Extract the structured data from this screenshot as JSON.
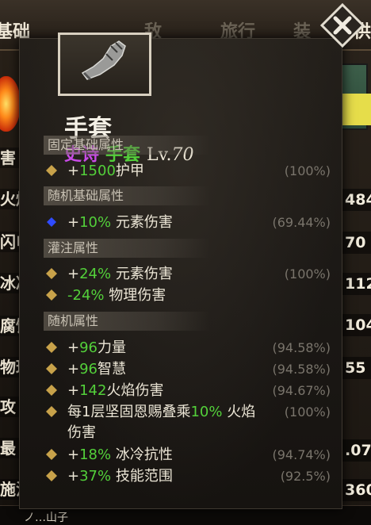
{
  "background": {
    "tabs": [
      "基础",
      "敌",
      "旅行",
      "装",
      "供"
    ],
    "left_labels": [
      "害",
      "火焰",
      "闪电",
      "冰冷",
      "腐蚀",
      "物理",
      "攻",
      "最",
      "施法"
    ],
    "right_values": [
      "484",
      "70",
      "112",
      "104",
      "55",
      ".07",
      "360"
    ],
    "bottom_text": "ノ…山子"
  },
  "item": {
    "name": "手套",
    "rarity": "史诗",
    "type": "手套",
    "level_prefix": "Lv.",
    "level": "70"
  },
  "close_icon": "close-icon",
  "sections": {
    "fixed_base": "固定基础属性",
    "random_base": "随机基础属性",
    "infusion": "灌注属性",
    "random": "随机属性"
  },
  "affixes": {
    "armor": {
      "prefix": "+",
      "value": "1500",
      "text": "护甲",
      "pct": "(100%)"
    },
    "elemental": {
      "prefix": "+",
      "value": "10",
      "unit": "%",
      "text": " 元素伤害",
      "pct": "(69.44%)"
    },
    "infuse_elemental": {
      "prefix": "+",
      "value": "24",
      "unit": "%",
      "text": " 元素伤害",
      "pct": "(100%)"
    },
    "infuse_physical": {
      "value": "-24",
      "unit": "%",
      "text": " 物理伤害"
    },
    "strength": {
      "prefix": "+",
      "value": "96",
      "text": "力量",
      "pct": "(94.58%)"
    },
    "intelligence": {
      "prefix": "+",
      "value": "96",
      "text": "智慧",
      "pct": "(94.58%)"
    },
    "fire": {
      "prefix": "+",
      "value": "142",
      "text": "火焰伤害",
      "pct": "(94.67%)"
    },
    "stack": {
      "pre": "每1层坚固恩赐叠乘",
      "value": "10",
      "unit": "%",
      "text": " 火焰",
      "line2": "伤害",
      "pct": "(100%)"
    },
    "cold_res": {
      "prefix": "+",
      "value": "18",
      "unit": "%",
      "text": " 冰冷抗性",
      "pct": "(94.74%)"
    },
    "skill_area": {
      "prefix": "+",
      "value": "37",
      "unit": "%",
      "text": " 技能范围",
      "pct": "(92.5%)"
    }
  },
  "colors": {
    "rarity": "#c84be6",
    "type": "#53d03a",
    "value_green": "#53d03a",
    "diamond_gold": "#c8a24a",
    "diamond_blue": "#2f4bff"
  }
}
